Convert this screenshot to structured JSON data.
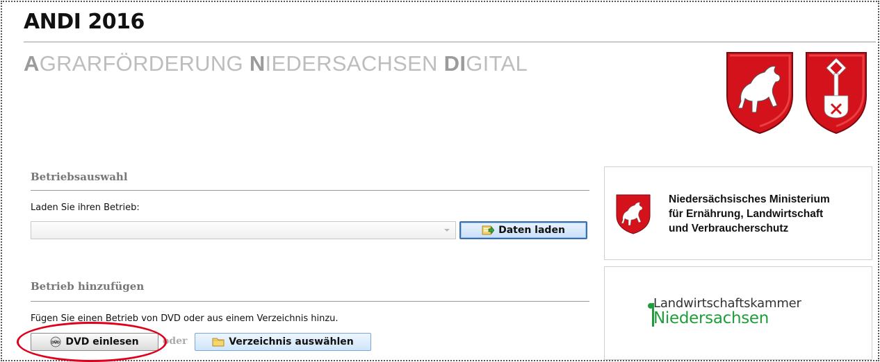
{
  "header": {
    "title": "ANDI 2016",
    "subtitle_parts": [
      {
        "bold": "A",
        "rest": "GRARFÖRDERUNG "
      },
      {
        "bold": "N",
        "rest": "IEDERSACHSEN "
      },
      {
        "bold": "DI",
        "rest": "GITAL"
      }
    ]
  },
  "betriebsauswahl": {
    "heading": "Betriebsauswahl",
    "prompt": "Laden Sie ihren Betrieb:",
    "select_value": "",
    "load_button": "Daten laden"
  },
  "betrieb_hinzufuegen": {
    "heading": "Betrieb hinzufügen",
    "prompt": "Fügen Sie einen Betrieb von DVD oder aus einem Verzeichnis hinzu.",
    "dvd_button": "DVD einlesen",
    "or_text": "oder",
    "dir_button": "Verzeichnis auswählen"
  },
  "ministry": {
    "line1": "Niedersächsisches Ministerium",
    "line2": "für Ernährung, Landwirtschaft",
    "line3": "und Verbraucherschutz"
  },
  "lwk": {
    "line1": "Landwirtschaftskammer",
    "line2": "Niedersachsen"
  },
  "colors": {
    "crest_red": "#d4121b",
    "lwk_green": "#1f9d3a",
    "highlight": "#e0001b"
  },
  "icons": [
    "coat-of-arms-niedersachsen-icon",
    "coat-of-arms-bremen-icon",
    "data-load-icon",
    "dvd-icon",
    "folder-icon"
  ]
}
